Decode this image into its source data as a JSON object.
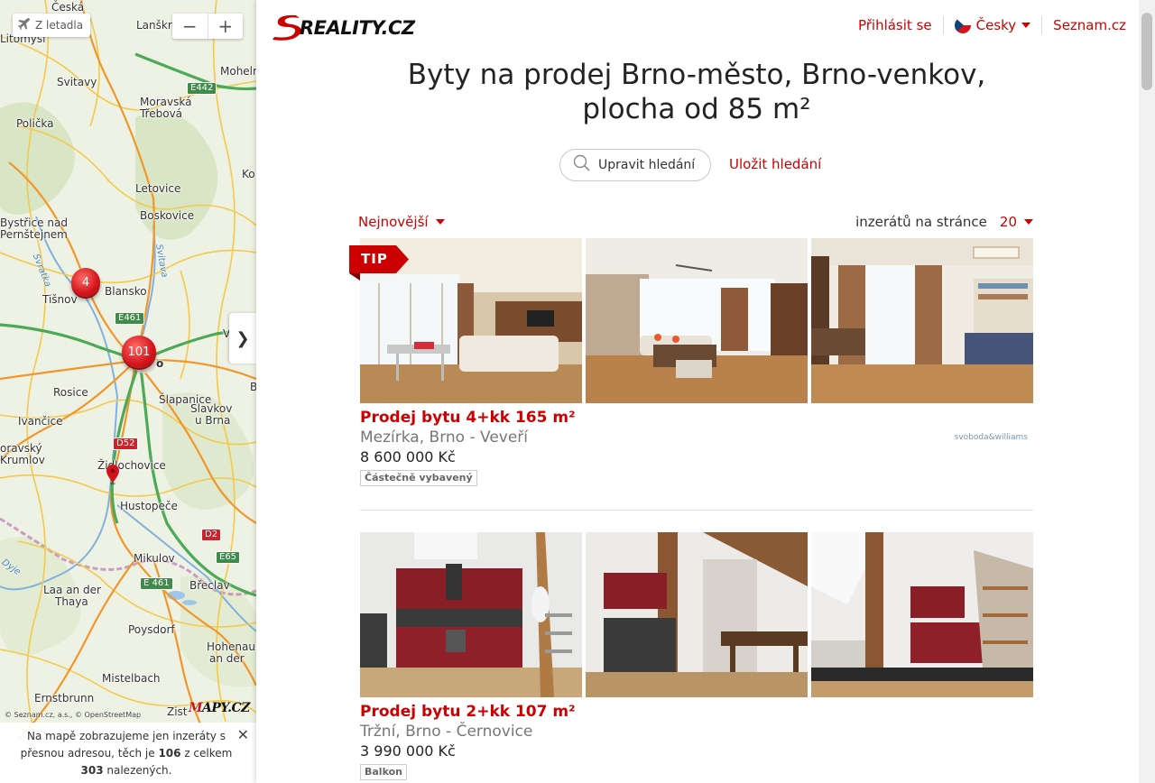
{
  "map": {
    "plane_button_label": "Z letadla",
    "zoom_out": "−",
    "zoom_in": "+",
    "places": {
      "ceska": "Česká",
      "litomysl": "Litomyšl",
      "lanskroun": "Lanškr",
      "svitavy": "Svitavy",
      "mohelnice": "Mohelr",
      "policka": "Polička",
      "moravska_trebova_1": "Moravská",
      "moravska_trebova_2": "Třebová",
      "letovice": "Letovice",
      "boskovice": "Boskovice",
      "bystrice_1": "Bystřice nad",
      "bystrice_2": "Pernštejnem",
      "tisnov": "Tišnov",
      "blansko": "Blansko",
      "rosice": "Rosice",
      "brno_suffix": "o",
      "slapanice": "Šlapanice",
      "slavkov_1": "Slavkov",
      "slavkov_2": "u Brna",
      "ivancice": "Ivančice",
      "mor_krumlov_1": "oravský",
      "mor_krumlov_2": "Krumlov",
      "zidlochovice": "Židlochovice",
      "hustopece": "Hustopeče",
      "mikulov": "Mikulov",
      "laa_1": "Laa an der",
      "laa_2": "Thaya",
      "breclav": "Břeclav",
      "poysdorf": "Poysdorf",
      "hohenau_1": "Hohenau",
      "hohenau_2": "an der",
      "mistelbach": "Mistelbach",
      "ernstbrunn": "Ernstbrunn",
      "zistersdorf": "Zist",
      "ko": "Ko",
      "v": "V",
      "b": "B"
    },
    "rivers": {
      "svratka": "Svratka",
      "svitava": "Svitava",
      "dyje": "Dyje"
    },
    "roads": {
      "e442": "E442",
      "e461": "E461",
      "d52": "D52",
      "d2": "D2",
      "e65": "E65",
      "e461b": "E 461"
    },
    "clusters": {
      "tisnov_count": "4",
      "brno_count": "101"
    },
    "collapse_glyph": "❯",
    "credits": "© Seznam.cz, a.s., © OpenStreetMap",
    "logo_red": "M",
    "logo_rest": "APY.CZ",
    "note": {
      "text_before": "Na mapě zobrazujeme jen inzeráty s přesnou adresou, těch je ",
      "count_exact": "106",
      "text_middle": " z celkem ",
      "count_total": "303",
      "text_after": " nalezených.",
      "close_glyph": "✕"
    }
  },
  "header": {
    "logo_text": "SREALITY.CZ",
    "login": "Přihlásit se",
    "language": "Česky",
    "seznam": "Seznam.cz"
  },
  "title": "Byty na prodej Brno-město, Brno-venkov, plocha od 85 m²",
  "search": {
    "edit_label": "Upravit hledání",
    "save_label": "Uložit hledání"
  },
  "sorting": {
    "sort_label": "Nejnovější",
    "per_page_label": "inzerátů na stránce",
    "per_page_value": "20"
  },
  "listings": [
    {
      "tip": "TIP",
      "title": "Prodej bytu 4+kk 165 m²",
      "location": "Mezírka, Brno - Veveří",
      "price": "8 600 000 Kč",
      "tag": "Částečně vybavený",
      "agency": "svoboda&williams"
    },
    {
      "title": "Prodej bytu 2+kk 107 m²",
      "location": "Tržní, Brno - Černovice",
      "price": "3 990 000 Kč",
      "tag": "Balkon"
    }
  ],
  "colors": {
    "accent": "#cc0000",
    "map_bg": "#eef2e4",
    "cluster": "#d3141b"
  }
}
